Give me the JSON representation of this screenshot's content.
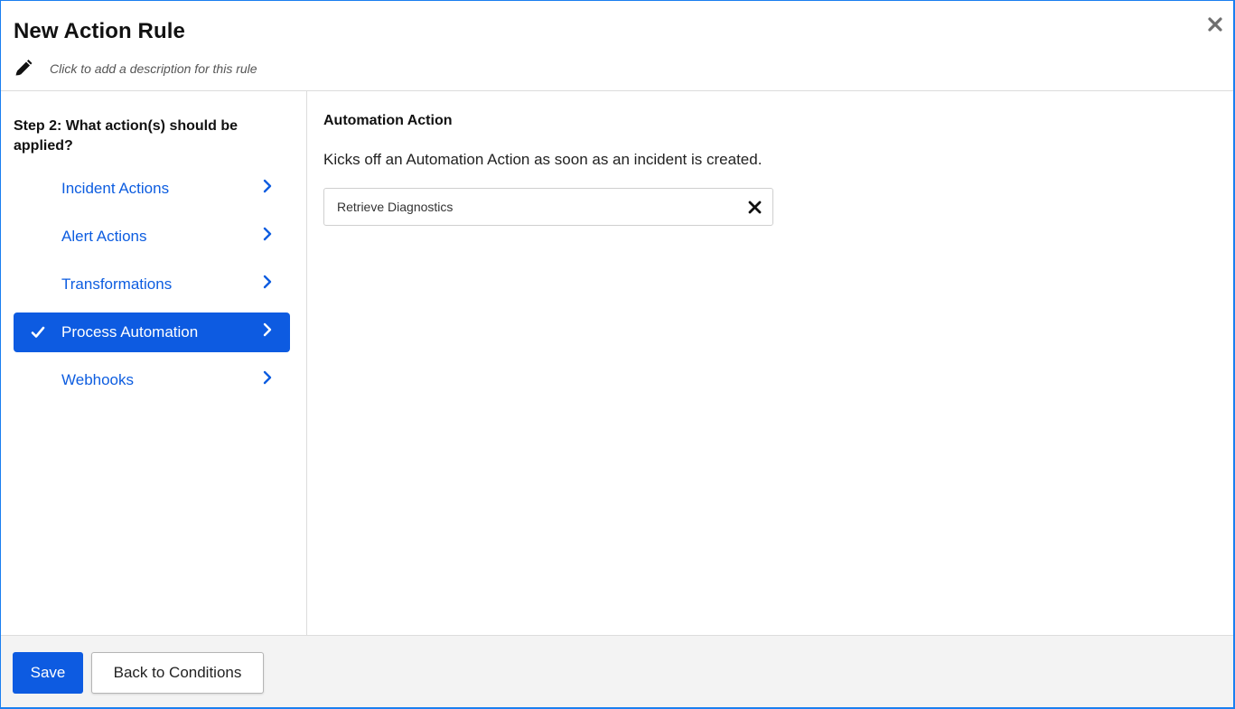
{
  "header": {
    "title": "New Action Rule",
    "description_placeholder": "Click to add a description for this rule",
    "icons": {
      "edit": "pencil-icon",
      "close": "close-icon"
    }
  },
  "sidebar": {
    "step_heading": "Step 2: What action(s) should be applied?",
    "items": [
      {
        "label": "Incident Actions",
        "active": false,
        "checked": false
      },
      {
        "label": "Alert Actions",
        "active": false,
        "checked": false
      },
      {
        "label": "Transformations",
        "active": false,
        "checked": false
      },
      {
        "label": "Process Automation",
        "active": true,
        "checked": true
      },
      {
        "label": "Webhooks",
        "active": false,
        "checked": false
      }
    ]
  },
  "main": {
    "section_title": "Automation Action",
    "section_description": "Kicks off an Automation Action as soon as an incident is created.",
    "selected_action": "Retrieve Diagnostics"
  },
  "footer": {
    "save_label": "Save",
    "back_label": "Back to Conditions"
  },
  "colors": {
    "primary": "#0d5be1",
    "link": "#0d5de0",
    "frame": "#1a7ff0",
    "footer_bg": "#f3f3f3"
  }
}
